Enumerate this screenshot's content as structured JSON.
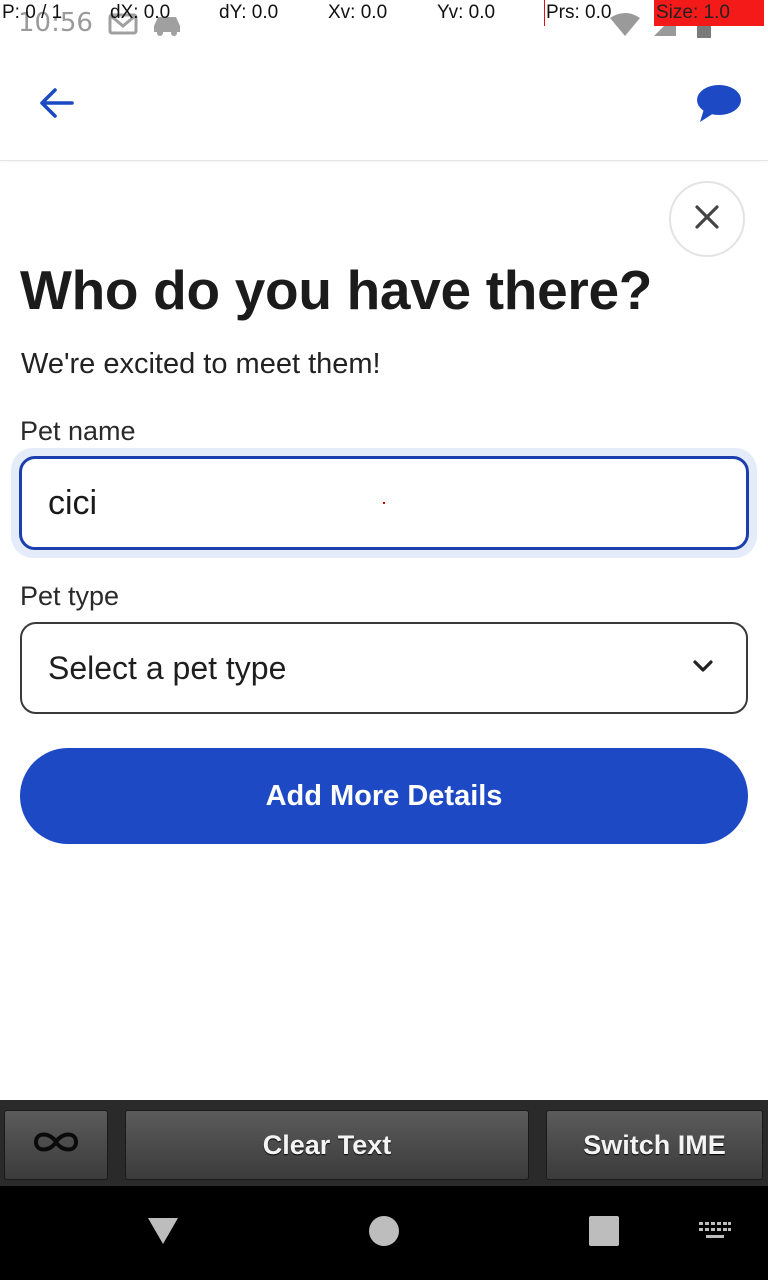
{
  "status_bar": {
    "time": "10:56",
    "debug": {
      "pointer": "P: 0 / 1",
      "dx": "dX: 0.0",
      "dy": "dY: 0.0",
      "xv": "Xv: 0.0",
      "yv": "Yv: 0.0",
      "prs": "Prs: 0.0",
      "size": "Size: 1.0"
    },
    "icons": [
      "gmail-icon",
      "car-icon",
      "wifi-icon",
      "signal-icon",
      "battery-icon"
    ]
  },
  "app_bar": {
    "back_icon": "arrow-left-icon",
    "chat_icon": "chat-bubble-icon",
    "accent_color": "#1d4ac4"
  },
  "dialog": {
    "close_icon": "close-icon",
    "title": "Who do you have there?",
    "subtitle": "We're excited to meet them!",
    "pet_name": {
      "label": "Pet name",
      "value": "cici"
    },
    "pet_type": {
      "label": "Pet type",
      "value": "Select a pet type"
    },
    "submit_label": "Add More Details"
  },
  "ime_toolbar": {
    "clear_label": "Clear Text",
    "switch_label": "Switch IME"
  },
  "nav_bar": {
    "items": [
      "back-icon",
      "home-icon",
      "recents-icon",
      "keyboard-icon"
    ]
  }
}
